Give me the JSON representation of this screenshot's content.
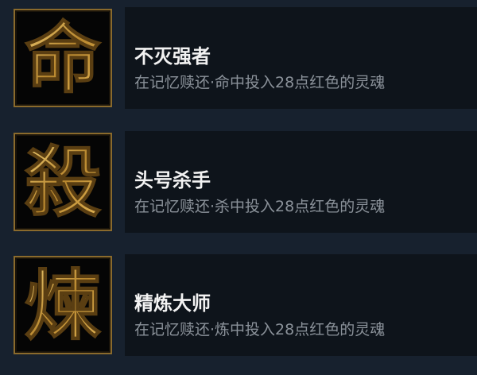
{
  "achievements": [
    {
      "icon_glyph": "命",
      "icon_name": "ming-glyph-icon",
      "title": "不灭强者",
      "description": "在记忆赎还·命中投入28点红色的灵魂"
    },
    {
      "icon_glyph": "殺",
      "icon_name": "sha-glyph-icon",
      "title": "头号杀手",
      "description": "在记忆赎还·杀中投入28点红色的灵魂"
    },
    {
      "icon_glyph": "煉",
      "icon_name": "lian-glyph-icon",
      "title": "精炼大师",
      "description": "在记忆赎还·炼中投入28点红色的灵魂"
    }
  ],
  "colors": {
    "background": "#17212e",
    "panel": "#0e141b",
    "title": "#f2f2f2",
    "description": "#8b929a",
    "gold": "#c9a048",
    "frame": "#8a6a2c"
  }
}
